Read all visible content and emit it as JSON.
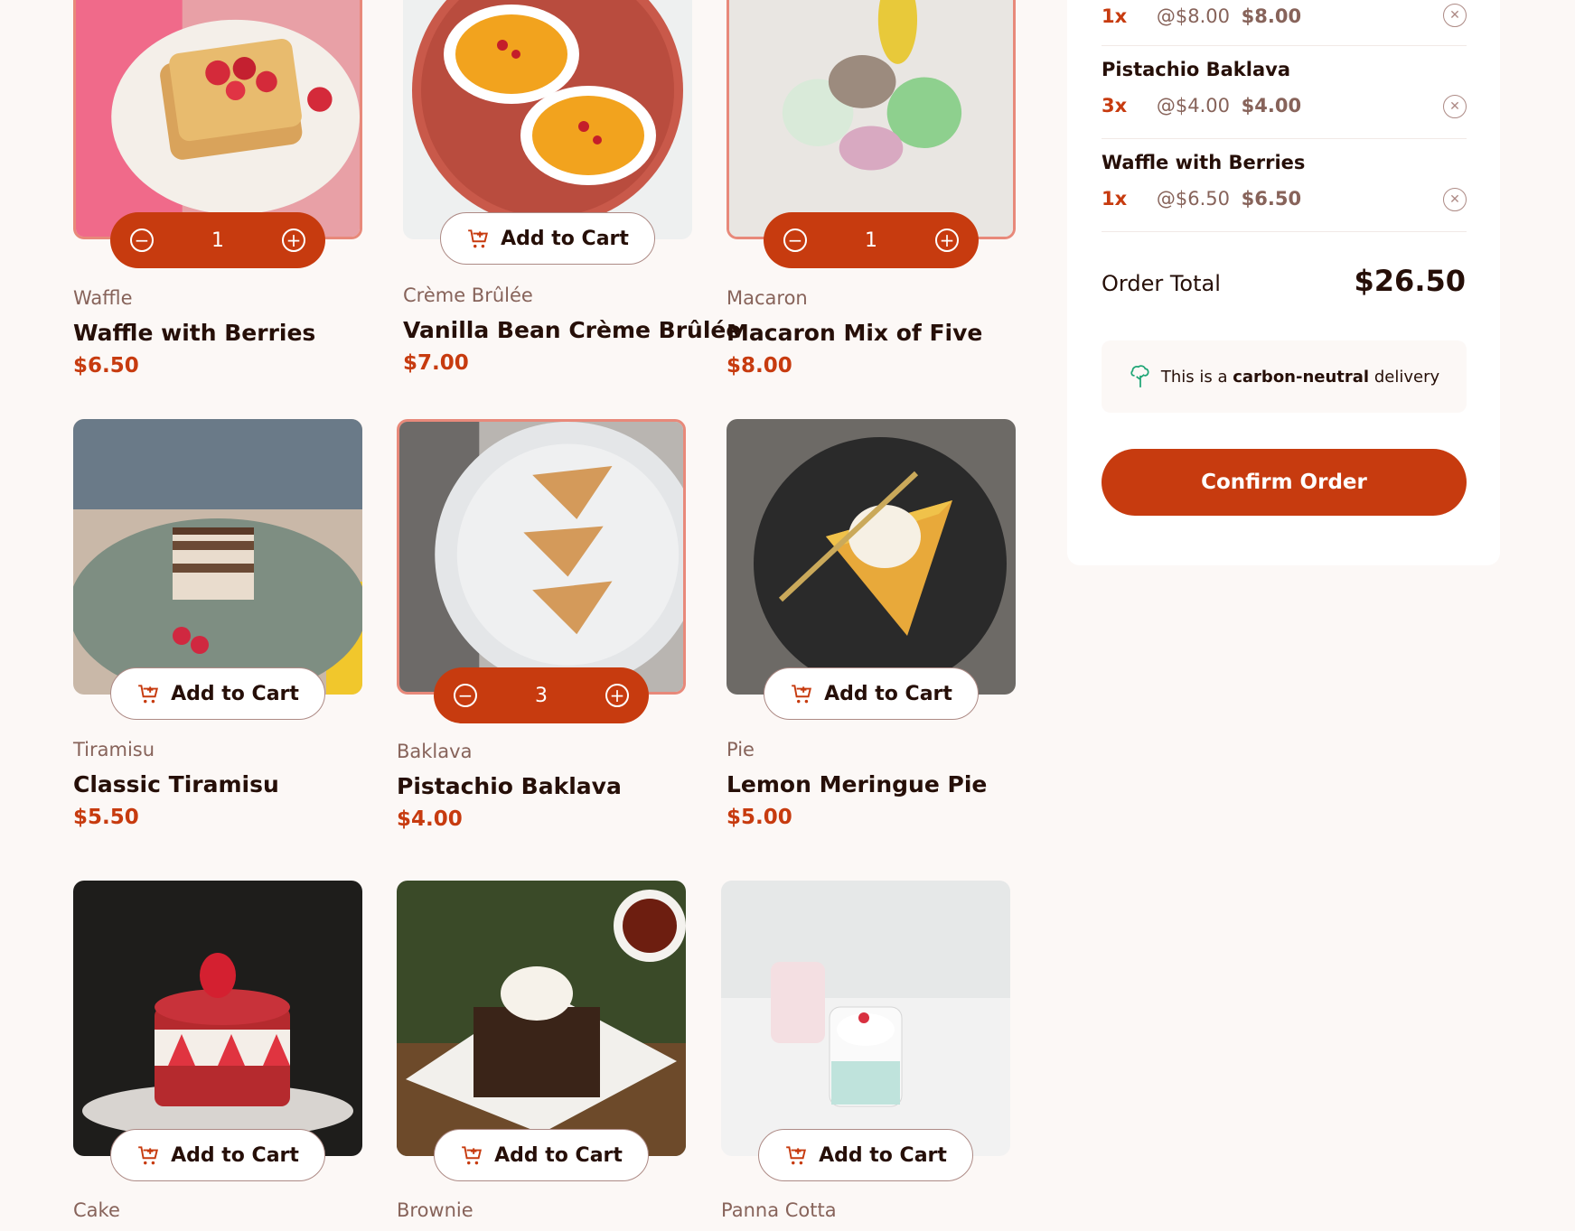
{
  "products": [
    {
      "category": "Waffle",
      "name": "Waffle with Berries",
      "price": "$6.50",
      "in_cart": true,
      "quantity": "1"
    },
    {
      "category": "Crème Brûlée",
      "name": "Vanilla Bean Crème Brûlée",
      "price": "$7.00",
      "in_cart": false,
      "add_label": "Add to Cart"
    },
    {
      "category": "Macaron",
      "name": "Macaron Mix of Five",
      "price": "$8.00",
      "in_cart": true,
      "quantity": "1"
    },
    {
      "category": "Tiramisu",
      "name": "Classic Tiramisu",
      "price": "$5.50",
      "in_cart": false,
      "add_label": "Add to Cart"
    },
    {
      "category": "Baklava",
      "name": "Pistachio Baklava",
      "price": "$4.00",
      "in_cart": true,
      "quantity": "3"
    },
    {
      "category": "Pie",
      "name": "Lemon Meringue Pie",
      "price": "$5.00",
      "in_cart": false,
      "add_label": "Add to Cart"
    },
    {
      "category": "Cake",
      "add_label": "Add to Cart"
    },
    {
      "category": "Brownie",
      "add_label": "Add to Cart"
    },
    {
      "category": "Panna Cotta",
      "add_label": "Add to Cart"
    }
  ],
  "cart": {
    "items": [
      {
        "quantity": "1x",
        "unit_price": "@$8.00",
        "subtotal": "$8.00"
      },
      {
        "name": "Pistachio Baklava",
        "quantity": "3x",
        "unit_price": "@$4.00",
        "subtotal": "$4.00"
      },
      {
        "name": "Waffle with Berries",
        "quantity": "1x",
        "unit_price": "@$6.50",
        "subtotal": "$6.50"
      }
    ],
    "total_label": "Order Total",
    "total_value": "$26.50",
    "carbon_prefix": "This is a",
    "carbon_bold": "carbon-neutral",
    "carbon_suffix": "delivery",
    "confirm_label": "Confirm Order"
  },
  "colors": {
    "accent": "#c73b0f",
    "background": "#fcf8f6",
    "muted": "#87635a"
  }
}
